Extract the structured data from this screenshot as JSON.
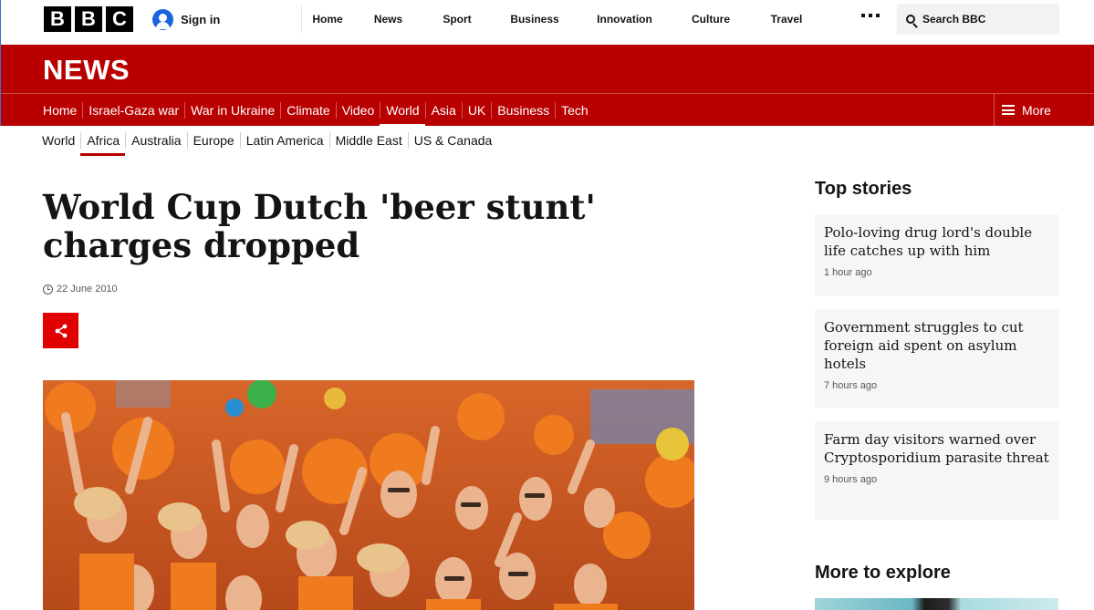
{
  "masthead": {
    "logo_letters": [
      "B",
      "B",
      "C"
    ],
    "signin_label": "Sign in",
    "nav": [
      "Home",
      "News",
      "Sport",
      "Business",
      "Innovation",
      "Culture",
      "Travel"
    ],
    "search_label": "Search BBC"
  },
  "newsbar": {
    "logo": "NEWS",
    "primary_nav": [
      "Home",
      "Israel-Gaza war",
      "War in Ukraine",
      "Climate",
      "Video",
      "World",
      "Asia",
      "UK",
      "Business",
      "Tech"
    ],
    "active_primary": "World",
    "more_label": "More"
  },
  "secondary_nav": {
    "items": [
      "World",
      "Africa",
      "Australia",
      "Europe",
      "Latin America",
      "Middle East",
      "US & Canada"
    ],
    "active": "Africa"
  },
  "article": {
    "headline": "World Cup Dutch 'beer stunt' charges dropped",
    "date": "22 June 2010"
  },
  "sidebar": {
    "top_stories_heading": "Top stories",
    "stories": [
      {
        "title": "Polo-loving drug lord's double life catches up with him",
        "time": "1 hour ago"
      },
      {
        "title": "Government struggles to cut foreign aid spent on asylum hotels",
        "time": "7 hours ago"
      },
      {
        "title": "Farm day visitors warned over Cryptosporidium parasite threat",
        "time": "9 hours ago"
      }
    ],
    "more_heading": "More to explore"
  },
  "colors": {
    "brand_red": "#b80000",
    "share_red": "#e00000",
    "signin_blue": "#1866dc"
  }
}
